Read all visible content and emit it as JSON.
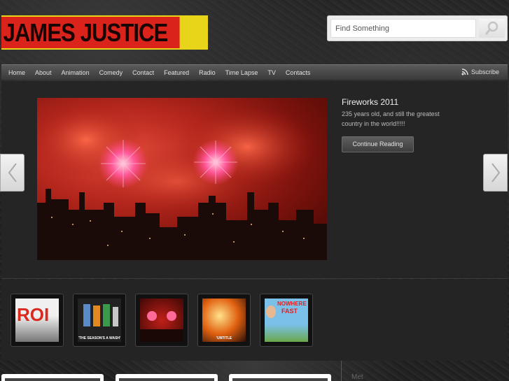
{
  "site": {
    "logo_text": "JAMES JUSTICE"
  },
  "search": {
    "placeholder": "Find Something"
  },
  "nav": {
    "items": [
      "Home",
      "About",
      "Animation",
      "Comedy",
      "Contact",
      "Featured",
      "Radio",
      "Time Lapse",
      "TV",
      "Contacts"
    ],
    "subscribe_label": "Subscribe"
  },
  "feature": {
    "title": "Fireworks 2011",
    "description": "235 years old, and still the greatest country in the world!!!!!",
    "button_label": "Continue Reading"
  },
  "thumbnails": [
    {
      "caption": ""
    },
    {
      "caption": "'THE SEASON'S A WASH'"
    },
    {
      "caption": ""
    },
    {
      "caption": "'UNTITLE"
    },
    {
      "caption": ""
    }
  ],
  "thumb_overlay_text": {
    "fast": "FAST",
    "nowhere": "NOWHERE"
  },
  "sidebar": {
    "meta_label": "Met"
  },
  "colors": {
    "logo_red": "#d9231b",
    "logo_yellow": "#e8d51a",
    "nav_bg": "#4a4a4a",
    "panel_bg": "#252525"
  }
}
